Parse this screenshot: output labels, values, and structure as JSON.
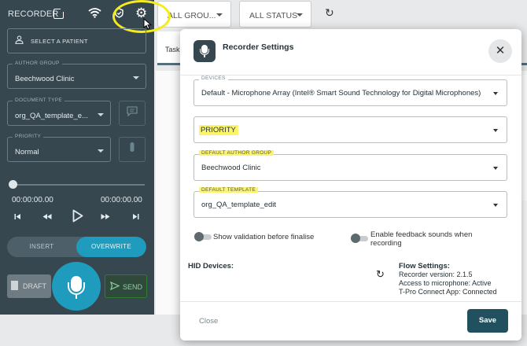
{
  "recorder": {
    "title": "RECORDER",
    "patient_button": "SELECT A PATIENT",
    "author_group": {
      "legend": "AUTHOR GROUP",
      "value": "Beechwood Clinic"
    },
    "document_type": {
      "legend": "DOCUMENT TYPE",
      "value": "org_QA_template_e..."
    },
    "priority": {
      "legend": "PRIORITY",
      "value": "Normal"
    },
    "time_elapsed": "00:00:00.00",
    "time_total": "00:00:00.00",
    "mode": {
      "insert": "INSERT",
      "overwrite": "OVERWRITE",
      "active": "overwrite"
    },
    "draft_label": "DRAFT",
    "send_label": "SEND",
    "icons": [
      "popout-icon",
      "wifi-icon",
      "shield-icon",
      "gear-icon",
      "person-icon",
      "chat-icon",
      "mic-icon",
      "skip-previous-icon",
      "rewind-icon",
      "play-icon",
      "fast-forward-icon",
      "skip-next-icon",
      "draft-icon",
      "send-icon"
    ]
  },
  "background": {
    "group_filter": "ALL GROU...",
    "status_filter": "ALL STATUS",
    "tab_label": "Task"
  },
  "modal": {
    "title": "Recorder Settings",
    "devices": {
      "legend": "DEVICES",
      "value": "Default - Microphone Array (Intel® Smart Sound Technology for Digital Microphones)"
    },
    "priority": {
      "value": "PRIORITY"
    },
    "author_group": {
      "legend": "DEFAULT AUTHOR GROUP",
      "value": "Beechwood Clinic"
    },
    "template": {
      "legend": "DEFAULT TEMPLATE",
      "value": "org_QA_template_edit"
    },
    "toggles": {
      "validation": {
        "label": "Show validation before finalise",
        "on": false
      },
      "feedback": {
        "label": "Enable feedback sounds when recording",
        "on": false
      }
    },
    "hid_label": "HID Devices:",
    "flow": {
      "title": "Flow Settings:",
      "version": "Recorder version: 2.1.5",
      "microphone": "Access to microphone: Active",
      "app": "T-Pro Connect App: Connected"
    },
    "close_label": "Close",
    "save_label": "Save"
  },
  "colors": {
    "panel": "#37474f",
    "accent": "#1f9bbd",
    "save": "#21505f",
    "highlight": "#fcf56b",
    "annotation_ring": "#f5eb1c"
  }
}
